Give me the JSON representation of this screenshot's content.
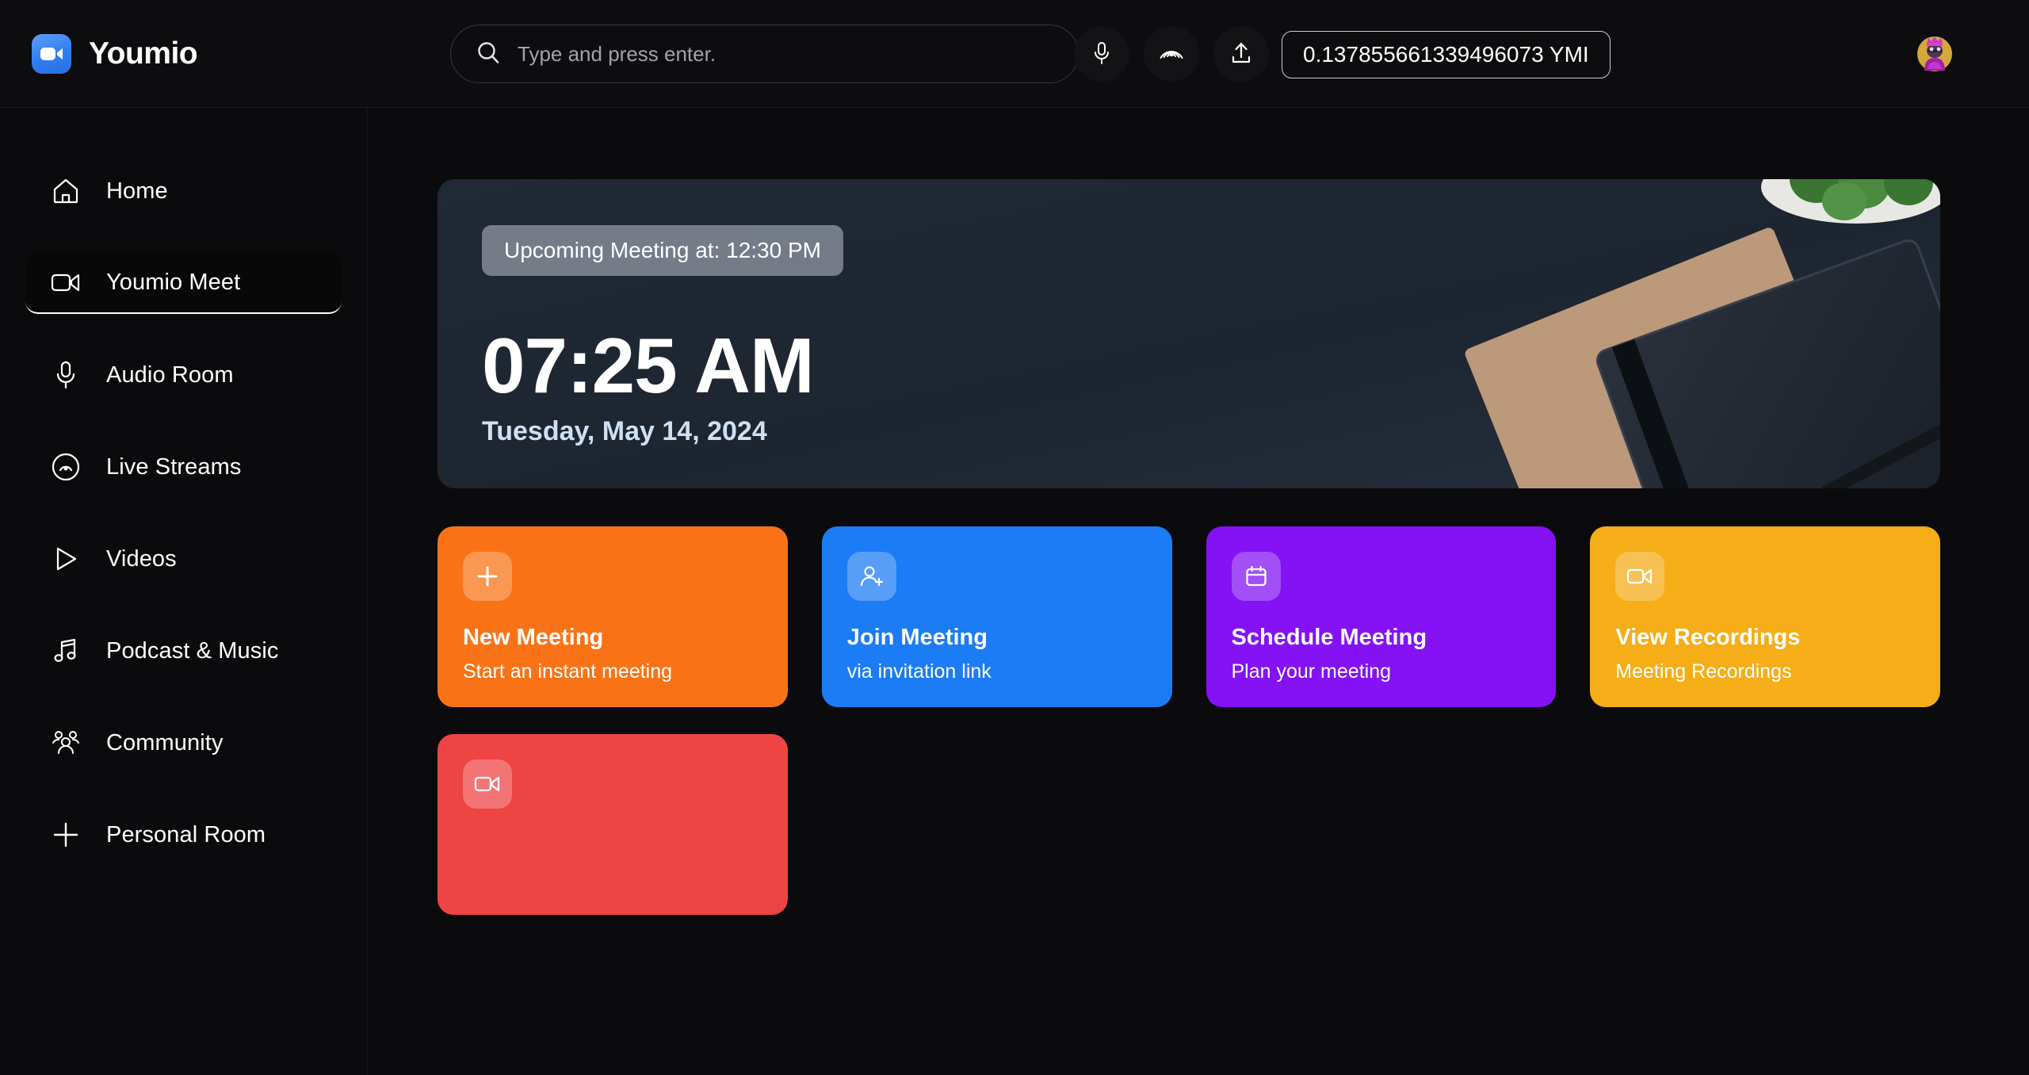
{
  "header": {
    "brand_name": "Youmio",
    "brand_logo_icon": "video-camera-icon",
    "search": {
      "placeholder": "Type and press enter.",
      "value": "",
      "icon": "search-icon"
    },
    "buttons": [
      {
        "name": "microphone-button",
        "icon": "microphone-icon"
      },
      {
        "name": "broadcast-button",
        "icon": "broadcast-icon"
      },
      {
        "name": "upload-button",
        "icon": "upload-icon"
      }
    ],
    "balance": "0.137855661339496073 YMI",
    "avatar": {
      "name": "user-avatar",
      "description": "pixel-art king character"
    }
  },
  "sidebar": {
    "items": [
      {
        "label": "Home",
        "icon": "home-icon",
        "active": false
      },
      {
        "label": "Youmio Meet",
        "icon": "video-camera-icon",
        "active": true
      },
      {
        "label": "Audio Room",
        "icon": "microphone-icon",
        "active": false
      },
      {
        "label": "Live Streams",
        "icon": "broadcast-icon",
        "active": false
      },
      {
        "label": "Videos",
        "icon": "play-icon",
        "active": false
      },
      {
        "label": "Podcast & Music",
        "icon": "music-note-icon",
        "active": false
      },
      {
        "label": "Community",
        "icon": "people-icon",
        "active": false
      },
      {
        "label": "Personal Room",
        "icon": "plus-icon",
        "active": false
      }
    ]
  },
  "hero": {
    "meeting_chip": "Upcoming Meeting at: 12:30 PM",
    "clock": "07:25 AM",
    "date": "Tuesday, May 14, 2024",
    "background_description": "dark navy desk with notebook, kraft folder, pencil and plant"
  },
  "cards": [
    {
      "title": "New Meeting",
      "subtitle": "Start an instant meeting",
      "color": "#f97316",
      "icon": "plus-icon",
      "name": "new-meeting-card"
    },
    {
      "title": "Join Meeting",
      "subtitle": "via invitation link",
      "color": "#1b7cf5",
      "icon": "person-add-icon",
      "name": "join-meeting-card"
    },
    {
      "title": "Schedule Meeting",
      "subtitle": "Plan your meeting",
      "color": "#8412f5",
      "icon": "calendar-icon",
      "name": "schedule-meeting-card"
    },
    {
      "title": "View Recordings",
      "subtitle": "Meeting Recordings",
      "color": "#f5ad18",
      "icon": "video-camera-icon",
      "name": "view-recordings-card"
    }
  ],
  "cards_row2": [
    {
      "title": "",
      "subtitle": "",
      "color": "#ef4444",
      "icon": "video-camera-icon",
      "name": "partially-visible-card"
    }
  ],
  "colors": {
    "background": "#0b0b0d",
    "header_bg": "#0d0d0f",
    "accent_blue": "#2f7df2",
    "hero_bg": "#232b38"
  }
}
